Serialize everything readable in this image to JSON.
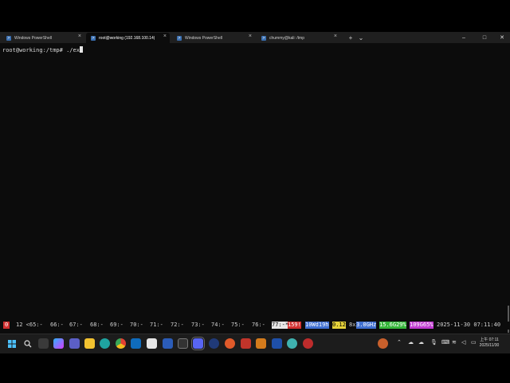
{
  "tabs": [
    {
      "label": "Windows PowerShell",
      "active": false
    },
    {
      "label": "root@working (192.168.100.14(",
      "active": true
    },
    {
      "label": "Windows PowerShell",
      "active": false
    },
    {
      "label": "chummy@kali: /tmp",
      "active": false
    }
  ],
  "tab_controls": {
    "new_tab": "+",
    "dropdown": "⌄"
  },
  "window_controls": {
    "minimize": "–",
    "maximize": "□",
    "close": "✕"
  },
  "terminal": {
    "prompt": "root@working:/tmp# ",
    "command": "./ex"
  },
  "statusbar": {
    "session_badge": "0",
    "windows": [
      "12 <65:-",
      "66:-",
      "67:-",
      "68:-",
      "69:-",
      "70:-",
      "71:-",
      "72:-",
      "73:-",
      "74:-",
      "75:-",
      "76:-",
      "77:-*",
      "159!"
    ],
    "uptime": "10Wd19h",
    "load": "0.12",
    "cpu": "8x",
    "cpu_freq": "3.0GHz",
    "mem": "15.6G29%",
    "disk": "109G65%",
    "datetime": "2025-11-30 07:11:40"
  },
  "taskbar": {
    "icons": [
      "windows-start-icon",
      "search-icon",
      "task-view-icon",
      "copilot-icon",
      "teams-icon",
      "file-explorer-icon",
      "edge-icon",
      "chrome-icon",
      "outlook-icon",
      "store-icon",
      "word-icon",
      "terminal-icon",
      "discord-icon",
      "power-icon",
      "app-icon",
      "git-icon",
      "ai-icon",
      "ide-icon",
      "calculator-icon",
      "browser-icon",
      "settings-icon"
    ],
    "clock_time": "上午 07:11",
    "clock_date": "2025/11/30",
    "colors": {
      "accent": "#0078d4",
      "statusbar_highlight_blue": "#3f6fd0",
      "statusbar_highlight_green": "#36b53a"
    }
  }
}
